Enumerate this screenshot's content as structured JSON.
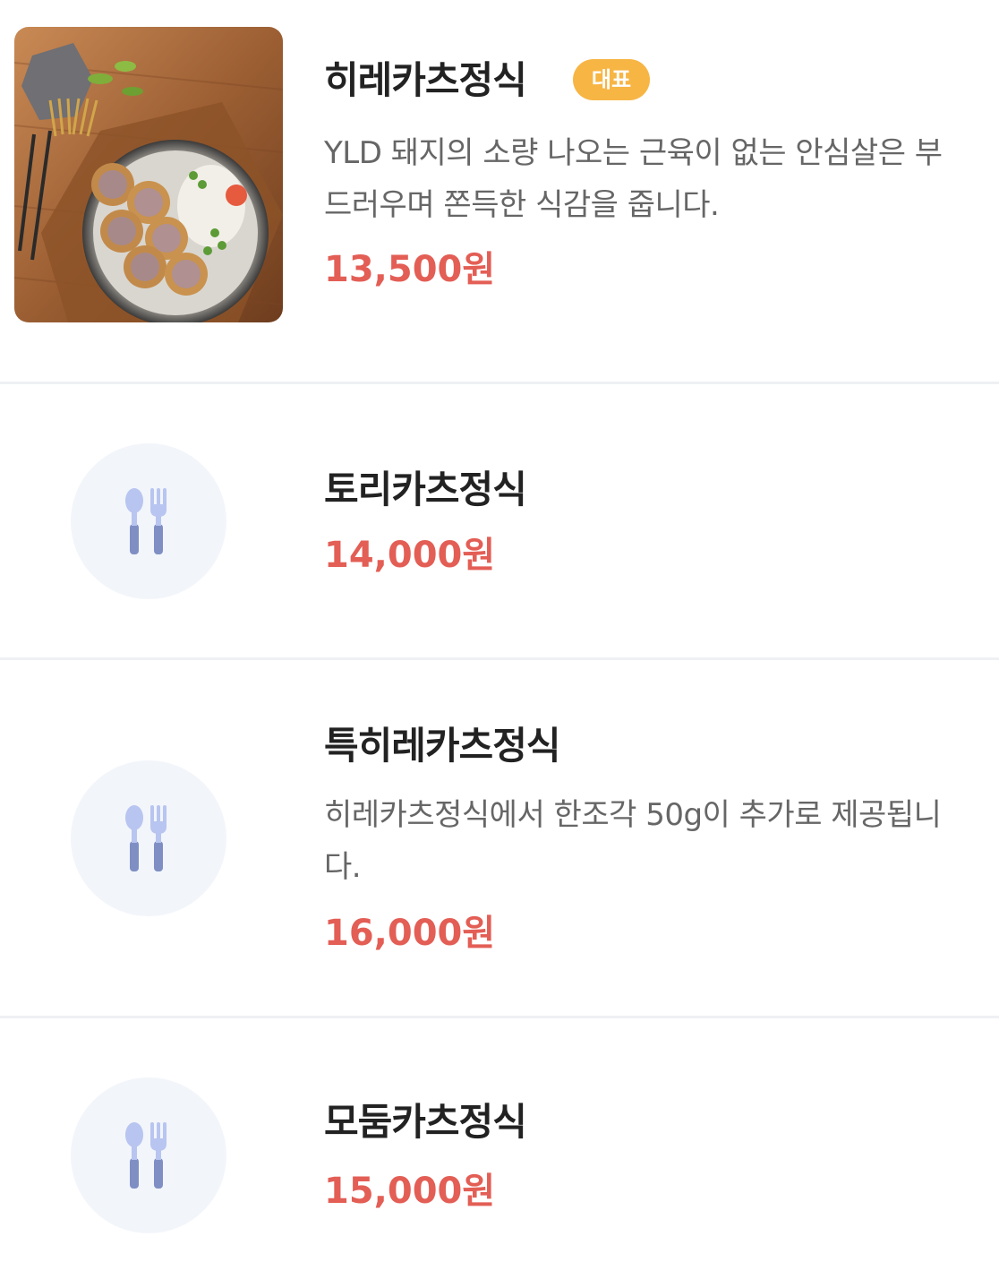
{
  "menu": {
    "items": [
      {
        "name": "히레카츠정식",
        "badge": "대표",
        "description": "YLD 돼지의 소량 나오는 근육이 없는 안심살은 부드러우며 쫀득한 식감을 줍니다.",
        "price": "13,500원",
        "thumbnail": "food-photo"
      },
      {
        "name": "토리카츠정식",
        "price": "14,000원",
        "thumbnail": "fork-spoon-icon"
      },
      {
        "name": "특히레카츠정식",
        "description": "히레카츠정식에서 한조각 50g이 추가로 제공됩니다.",
        "price": "16,000원",
        "thumbnail": "fork-spoon-icon"
      },
      {
        "name": "모둠카츠정식",
        "price": "15,000원",
        "thumbnail": "fork-spoon-icon"
      }
    ]
  },
  "colors": {
    "price": "#e35e55",
    "badge": "#f7b544",
    "placeholder_bg": "#f2f5fa",
    "icon": "#7f8fc4"
  }
}
